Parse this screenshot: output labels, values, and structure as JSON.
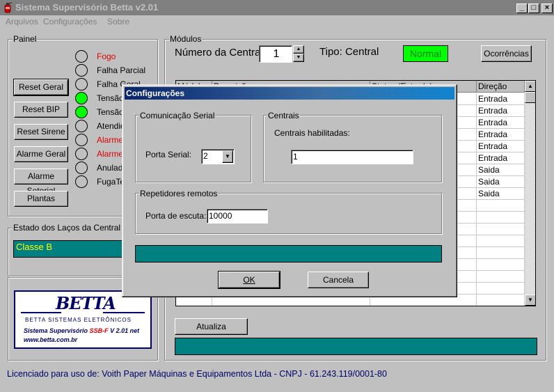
{
  "window": {
    "title": "Sistema Supervisório Betta v2.01",
    "minimize": "_",
    "maximize": "□",
    "close": "×"
  },
  "menu": [
    {
      "label": "Arquivos"
    },
    {
      "label": "Configurações"
    },
    {
      "label": "Sobre"
    }
  ],
  "painel": {
    "title": "Painel",
    "buttons": [
      "Reset Geral",
      "Reset BIP",
      "Reset Sirene",
      "Alarme Geral",
      "Alarme Setorial",
      "Plantas"
    ],
    "indicators": [
      {
        "label": "Fogo",
        "on": false,
        "color": "#e00000"
      },
      {
        "label": "Falha Parcial",
        "on": false,
        "color": "#000000"
      },
      {
        "label": "Falha Geral",
        "on": false,
        "color": "#000000"
      },
      {
        "label": "Tensão",
        "on": true,
        "color": "#000000"
      },
      {
        "label": "Tensão",
        "on": true,
        "color": "#000000"
      },
      {
        "label": "Atendido",
        "on": false,
        "color": "#000000"
      },
      {
        "label": "Alarme",
        "on": false,
        "color": "#e00000"
      },
      {
        "label": "Alarme",
        "on": false,
        "color": "#e00000"
      },
      {
        "label": "Anulado",
        "on": false,
        "color": "#000000"
      },
      {
        "label": "FugaTerra",
        "on": false,
        "color": "#000000"
      }
    ]
  },
  "estado": {
    "title": "Estado dos Laços da Central Atual",
    "value": "Classe B"
  },
  "logo": {
    "brand": "BETTA",
    "company": "Betta Sistemas Eletrônicos",
    "product_prefix": "Sistema Supervisório",
    "product_code": "SSB-F",
    "product_suffix": "V 2.01 net",
    "website": "www.betta.com.br"
  },
  "modulos": {
    "title": "Módulos",
    "central_label": "Número da Central:",
    "central_value": "1",
    "tipo": "Tipo: Central",
    "status": "Normal",
    "status_color": "#00ff00",
    "ocorrencias": "Ocorrências",
    "columns": [
      "Módulo",
      "Descrição",
      "Status (Entrada)",
      "Direção"
    ],
    "rows": [
      {
        "direcao": "Entrada"
      },
      {
        "direcao": "Entrada"
      },
      {
        "direcao": "Entrada"
      },
      {
        "direcao": "Entrada"
      },
      {
        "direcao": "Entrada"
      },
      {
        "direcao": "Entrada"
      },
      {
        "direcao": "Saida"
      },
      {
        "direcao": "Saida"
      },
      {
        "direcao": "Saida"
      },
      {
        "direcao": ""
      },
      {
        "direcao": ""
      },
      {
        "direcao": ""
      },
      {
        "direcao": ""
      },
      {
        "direcao": ""
      },
      {
        "direcao": ""
      },
      {
        "direcao": ""
      },
      {
        "direcao": ""
      },
      {
        "direcao": ""
      }
    ],
    "atualiza": "Atualiza Descrições"
  },
  "footer": {
    "license": "Licenciado para uso de: Voith Paper Máquinas e Equipamentos Ltda - CNPJ - 61.243.119/0001-80"
  },
  "dialog": {
    "title": "Configurações",
    "serial_group": "Comunicação Serial",
    "serial_label": "Porta Serial:",
    "serial_value": "2",
    "centrais_group": "Centrais",
    "centrais_label": "Centrais habilitadas:",
    "centrais_value": "1",
    "repetidores_group": "Repetidores remotos",
    "porta_label": "Porta de escuta:",
    "porta_value": "10000",
    "ok": "OK",
    "cancel": "Cancela"
  }
}
